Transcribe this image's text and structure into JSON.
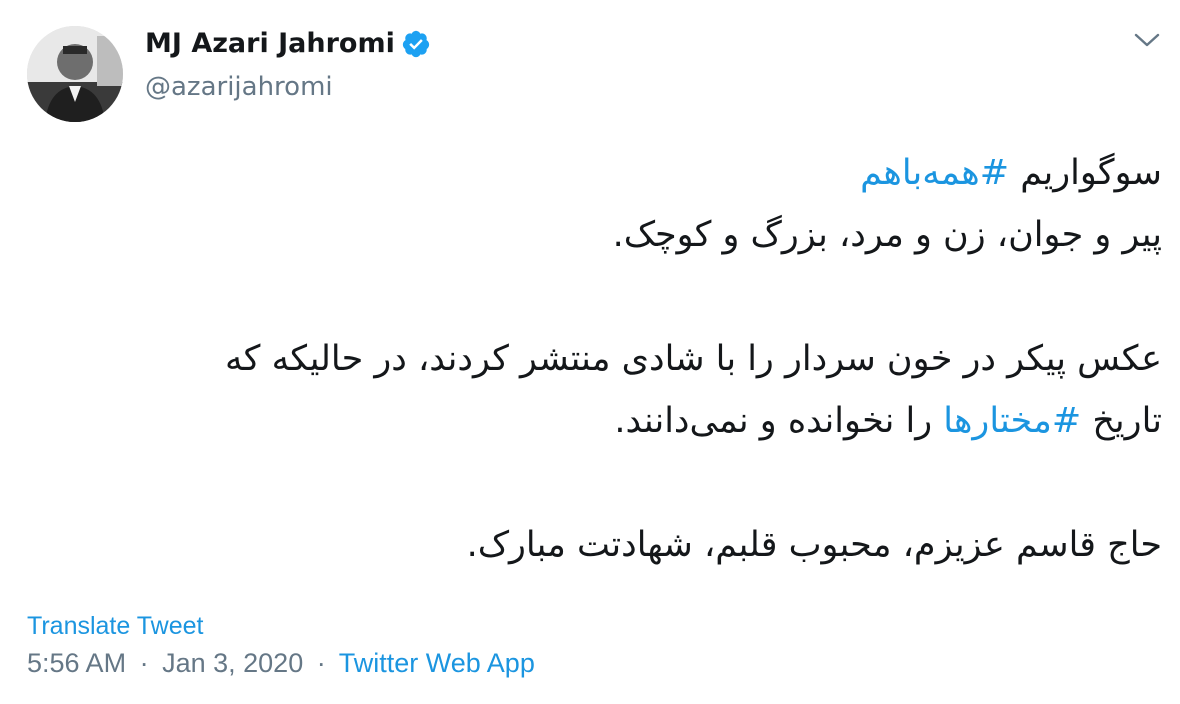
{
  "author": {
    "name": "MJ Azari Jahromi",
    "handle": "@azarijahromi",
    "verified": true,
    "avatar_icon": "profile-photo"
  },
  "menu": {
    "icon": "chevron-down-icon"
  },
  "tweet": {
    "line1_prefix": "سوگواریم ",
    "line1_hashtag": "#همه‌باهم",
    "line2": "پیر و جوان، زن و مرد، بزرگ و کوچک.",
    "line3": "عکس پیکر در خون سردار را با شادی منتشر کردند، در حالیکه که",
    "line4_prefix": "تاریخ ",
    "line4_hashtag": "#مختارها",
    "line4_suffix": " را نخوانده و نمی‌دانند.",
    "line5": "حاج قاسم عزیزم، محبوب قلبم، شهادتت مبارک."
  },
  "footer": {
    "translate_label": "Translate Tweet",
    "time": "5:56 AM",
    "separator": "·",
    "date": "Jan 3, 2020",
    "source": "Twitter Web App"
  },
  "colors": {
    "link": "#1b95e0",
    "secondary": "#657786",
    "primary_text": "#14171a"
  }
}
